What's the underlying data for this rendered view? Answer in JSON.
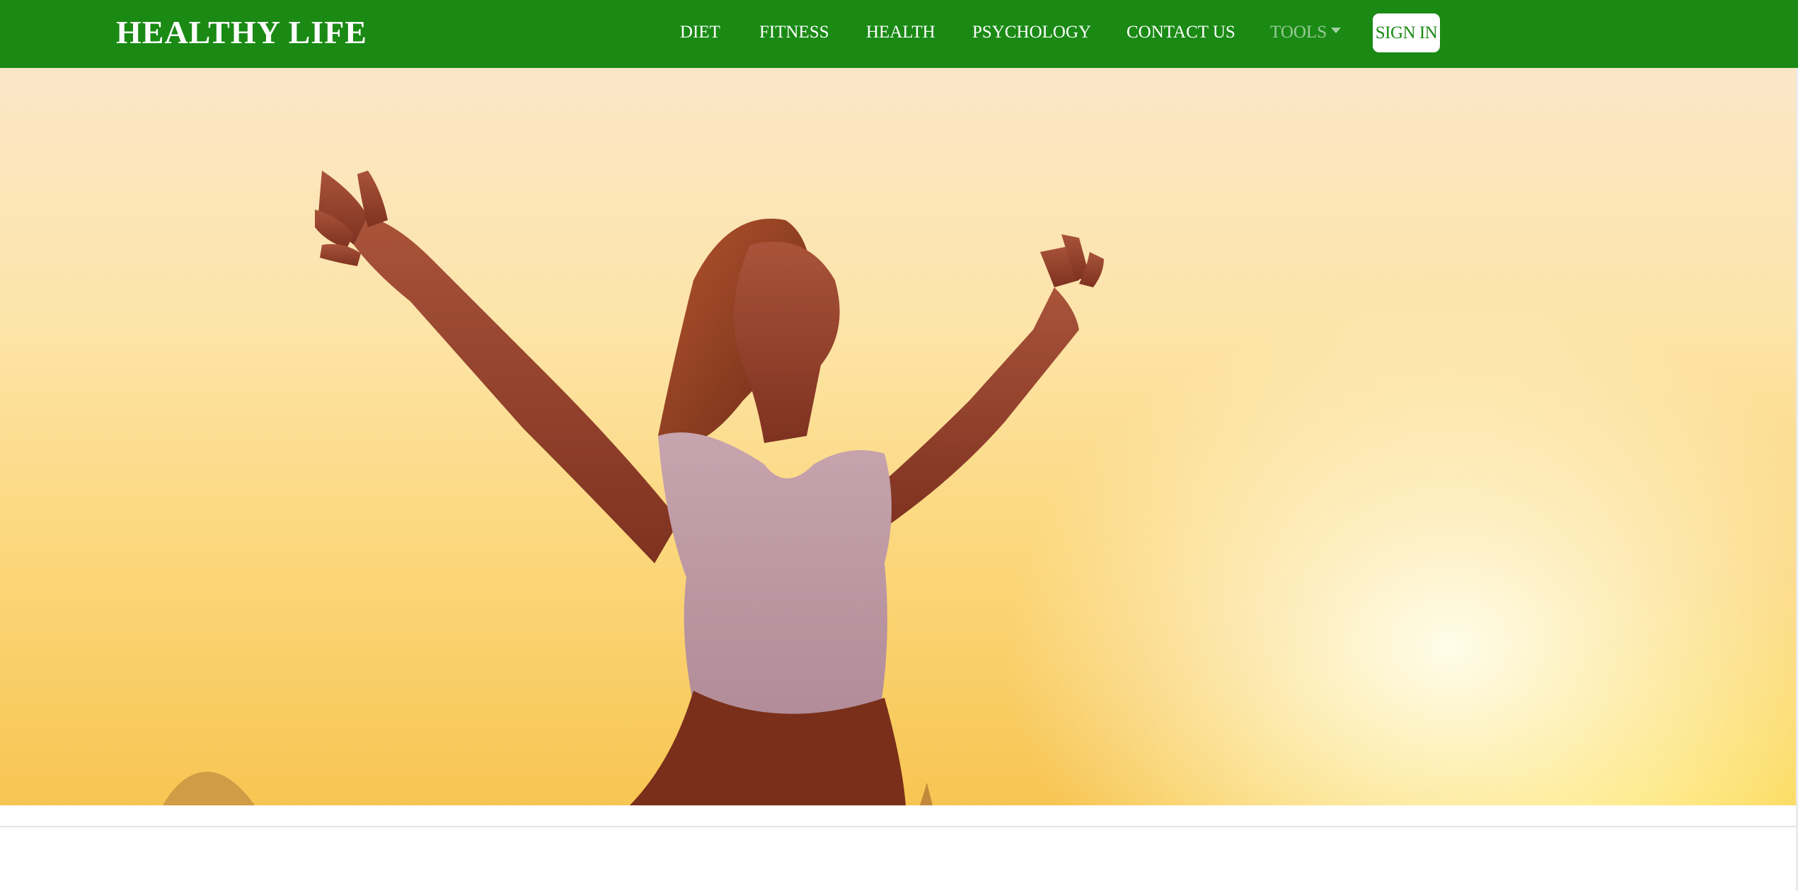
{
  "brand": "HEALTHY LIFE",
  "nav": {
    "items": [
      "DIET",
      "FITNESS",
      "HEALTH",
      "PSYCHOLOGY",
      "CONTACT US"
    ],
    "tools_label": "TOOLS",
    "signin_label": "SIGN IN"
  },
  "colors": {
    "navbar": "#1a8a14",
    "text_light": "#ffffff",
    "signin_bg": "#ffffff"
  },
  "hero": {
    "image_description_icon": "woman-arms-raised-sunset-image"
  }
}
